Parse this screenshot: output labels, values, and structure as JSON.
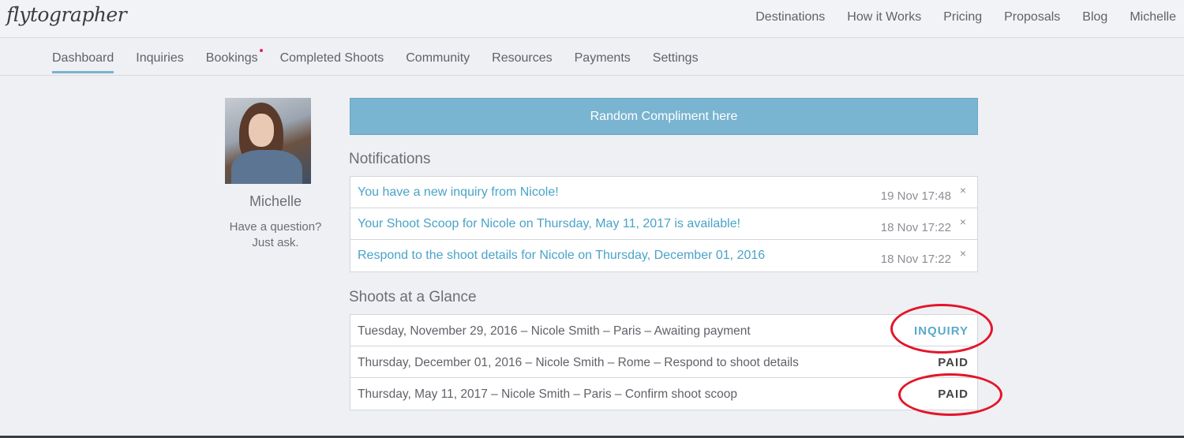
{
  "header": {
    "logo_text": "flytographer",
    "nav": [
      "Destinations",
      "How it Works",
      "Pricing",
      "Proposals",
      "Blog",
      "Michelle"
    ]
  },
  "subnav": {
    "items": [
      "Dashboard",
      "Inquiries",
      "Bookings",
      "Completed Shoots",
      "Community",
      "Resources",
      "Payments",
      "Settings"
    ],
    "active": "Dashboard",
    "badge_on": "Bookings"
  },
  "profile": {
    "name": "Michelle",
    "help_line1": "Have a question?",
    "help_line2": "Just ask."
  },
  "compliment": {
    "label": "Random Compliment here"
  },
  "notifications": {
    "title": "Notifications",
    "items": [
      {
        "text": "You have a new inquiry from Nicole!",
        "time": "19 Nov 17:48",
        "close": "×"
      },
      {
        "text": "Your Shoot Scoop for Nicole on Thursday, May 11, 2017 is available!",
        "time": "18 Nov 17:22",
        "close": "×"
      },
      {
        "text": "Respond to the shoot details for Nicole on Thursday, December 01, 2016",
        "time": "18 Nov 17:22",
        "close": "×"
      }
    ]
  },
  "shoots": {
    "title": "Shoots at a Glance",
    "items": [
      {
        "text": "Tuesday, November 29, 2016 – Nicole Smith – Paris – Awaiting payment",
        "status": "INQUIRY"
      },
      {
        "text": "Thursday, December 01, 2016 – Nicole Smith – Rome – Respond to shoot details",
        "status": "PAID"
      },
      {
        "text": "Thursday, May 11, 2017 – Nicole Smith – Paris – Confirm shoot scoop",
        "status": "PAID"
      }
    ]
  },
  "colors": {
    "accent": "#79b4d0",
    "link": "#4aa3c8",
    "annotation": "#e3152a",
    "badge": "#e2265a"
  }
}
